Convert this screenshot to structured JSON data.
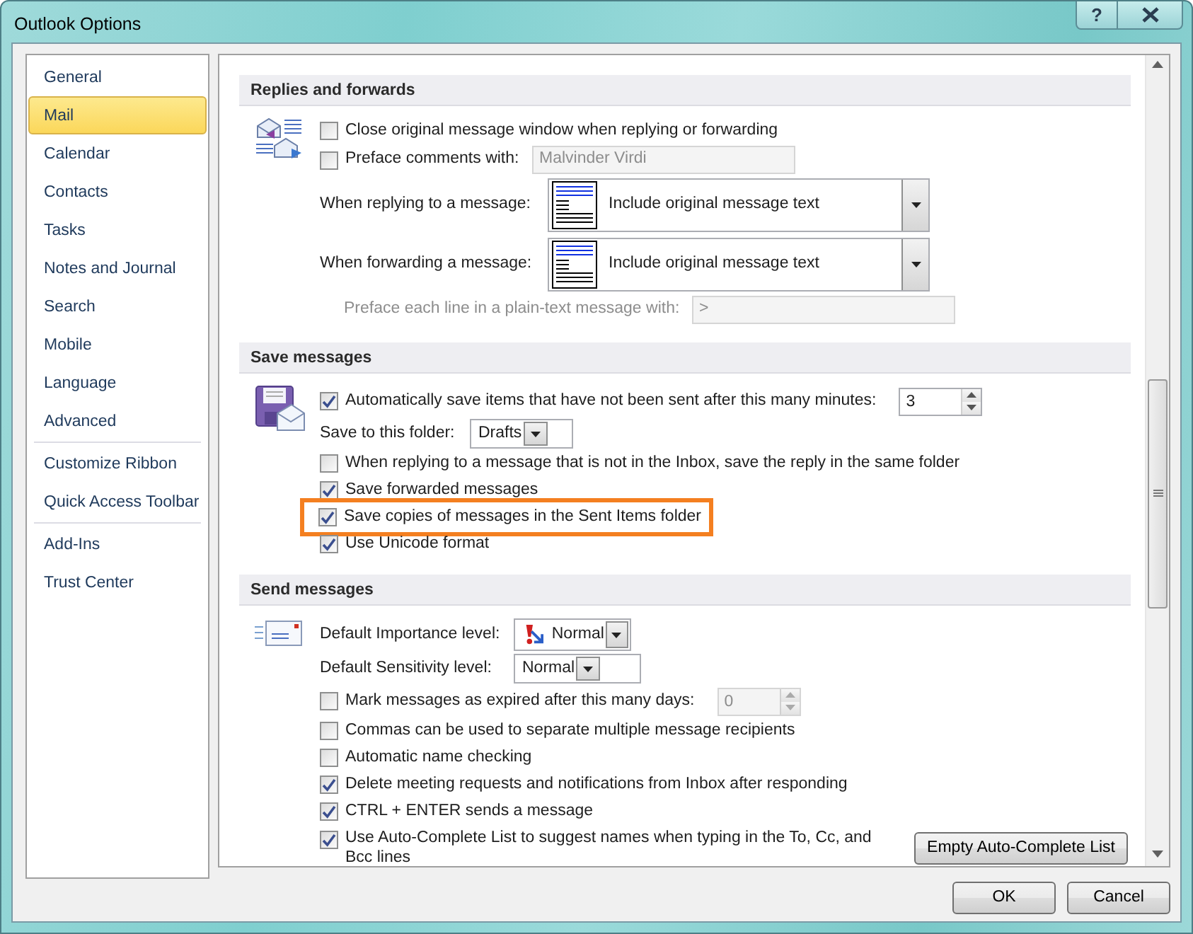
{
  "window": {
    "title": "Outlook Options",
    "help_button": "?"
  },
  "sidebar": {
    "groups": [
      [
        {
          "label": "General",
          "selected": false
        },
        {
          "label": "Mail",
          "selected": true
        },
        {
          "label": "Calendar",
          "selected": false
        },
        {
          "label": "Contacts",
          "selected": false
        },
        {
          "label": "Tasks",
          "selected": false
        },
        {
          "label": "Notes and Journal",
          "selected": false
        },
        {
          "label": "Search",
          "selected": false
        },
        {
          "label": "Mobile",
          "selected": false
        },
        {
          "label": "Language",
          "selected": false
        },
        {
          "label": "Advanced",
          "selected": false
        }
      ],
      [
        {
          "label": "Customize Ribbon",
          "selected": false
        },
        {
          "label": "Quick Access Toolbar",
          "selected": false
        }
      ],
      [
        {
          "label": "Add-Ins",
          "selected": false
        },
        {
          "label": "Trust Center",
          "selected": false
        }
      ]
    ]
  },
  "sections": [
    {
      "kind": "replies",
      "title": "Replies and forwards",
      "rows": [
        {
          "kind": "checkbox",
          "label": "Close original message window when replying or forwarding",
          "checked": false
        },
        {
          "kind": "checkbox-field",
          "label": "Preface comments with:",
          "checked": false,
          "value": "Malvinder Virdi",
          "disabled": true
        },
        {
          "kind": "combo",
          "label": "When replying to a message:",
          "value": "Include original message text"
        },
        {
          "kind": "combo",
          "label": "When forwarding a message:",
          "value": "Include original message text"
        },
        {
          "kind": "field",
          "label": "Preface each line in a plain-text message with:",
          "value": ">",
          "disabled": true
        }
      ]
    },
    {
      "kind": "save",
      "title": "Save messages",
      "rows": [
        {
          "kind": "checkbox-spinner",
          "label": "Automatically save items that have not been sent after this many minutes:",
          "checked": true,
          "value": "3",
          "disabled": false
        },
        {
          "kind": "select",
          "label": "Save to this folder:",
          "value": "Drafts"
        },
        {
          "kind": "checkbox",
          "label": "When replying to a message that is not in the Inbox, save the reply in the same folder",
          "checked": false
        },
        {
          "kind": "checkbox",
          "label": "Save forwarded messages",
          "checked": true
        },
        {
          "kind": "checkbox",
          "label": "Save copies of messages in the Sent Items folder",
          "checked": true,
          "highlighted": true
        },
        {
          "kind": "checkbox",
          "label": "Use Unicode format",
          "checked": true
        }
      ]
    },
    {
      "kind": "send",
      "title": "Send messages",
      "rows": [
        {
          "kind": "importance-select",
          "label": "Default Importance level:",
          "value": "Normal"
        },
        {
          "kind": "select",
          "label": "Default Sensitivity level:",
          "value": "Normal"
        },
        {
          "kind": "checkbox-spinner",
          "label": "Mark messages as expired after this many days:",
          "checked": false,
          "value": "0",
          "disabled": true
        },
        {
          "kind": "checkbox",
          "label": "Commas can be used to separate multiple message recipients",
          "checked": false
        },
        {
          "kind": "checkbox",
          "label": "Automatic name checking",
          "checked": false
        },
        {
          "kind": "checkbox",
          "label": "Delete meeting requests and notifications from Inbox after responding",
          "checked": true
        },
        {
          "kind": "checkbox",
          "label": "CTRL + ENTER sends a message",
          "checked": true
        },
        {
          "kind": "checkbox-button",
          "label": "Use Auto-Complete List to suggest names when typing in the To, Cc, and Bcc lines",
          "checked": true,
          "button": "Empty Auto-Complete List"
        }
      ]
    }
  ],
  "buttons": [
    "OK",
    "Cancel"
  ]
}
